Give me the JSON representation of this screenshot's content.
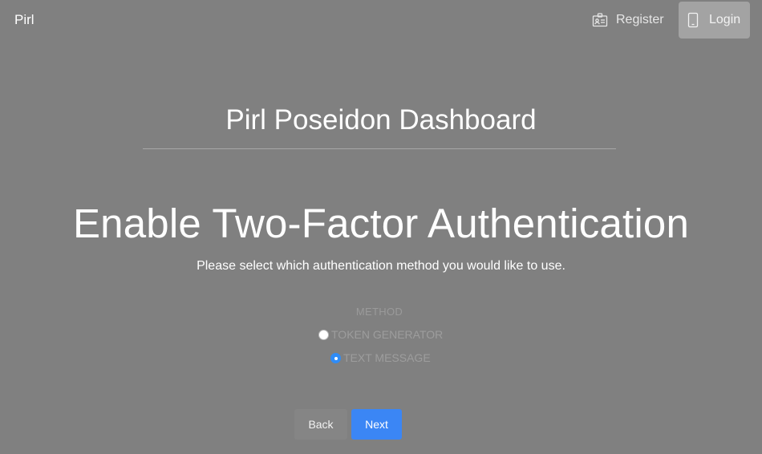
{
  "nav": {
    "brand": "Pirl",
    "register_label": "Register",
    "login_label": "Login",
    "register_icon": "id-card-icon",
    "login_icon": "mobile-phone-icon"
  },
  "dashboard_title": "Pirl Poseidon Dashboard",
  "page_title": "Enable Two-Factor Authentication",
  "subtitle": "Please select which authentication method you would like to use.",
  "method": {
    "label": "METHOD",
    "options": [
      {
        "label": "TOKEN GENERATOR",
        "selected": false
      },
      {
        "label": "TEXT MESSAGE",
        "selected": true
      }
    ]
  },
  "buttons": {
    "back_label": "Back",
    "next_label": "Next"
  },
  "colors": {
    "overlay_background": "#808080",
    "primary": "#3b86f5",
    "radio_selected": "#2f8cf7"
  }
}
